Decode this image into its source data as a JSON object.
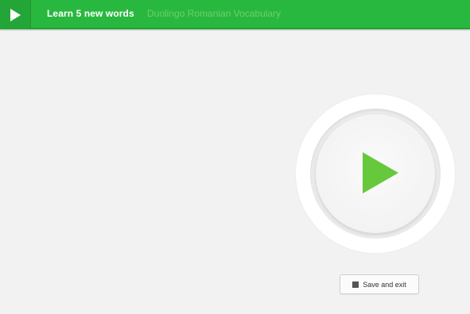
{
  "header": {
    "play_icon": "play-icon",
    "title": "Learn 5 new words",
    "subtitle": "Duolingo Romanian Vocabulary"
  },
  "player": {
    "play_icon": "play-icon",
    "accent_color": "#66c93b"
  },
  "actions": {
    "save_exit_label": "Save and exit",
    "save_exit_icon": "stop-icon"
  },
  "colors": {
    "brand_green": "#29b83f",
    "background": "#f2f2f2"
  }
}
